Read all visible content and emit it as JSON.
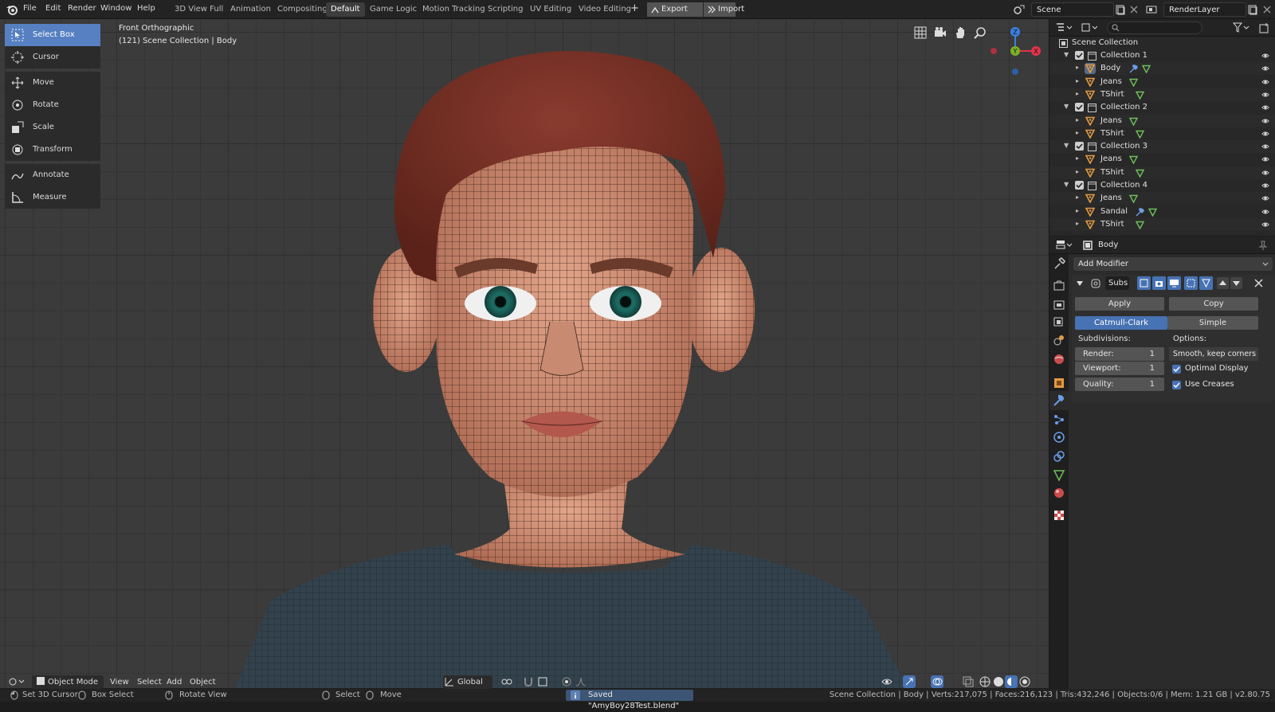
{
  "menus": [
    "File",
    "Edit",
    "Render",
    "Window",
    "Help"
  ],
  "workspaces": [
    "3D View Full",
    "Animation",
    "Compositing",
    "Default",
    "Game Logic",
    "Motion Tracking",
    "Scripting",
    "UV Editing",
    "Video Editing"
  ],
  "active_workspace": "Default",
  "topbar": {
    "export_label": "Export",
    "import_label": "Import",
    "scene": "Scene",
    "render_layer": "RenderLayer",
    "add_tab": "+"
  },
  "tools": [
    "Select Box",
    "Cursor",
    "Move",
    "Rotate",
    "Scale",
    "Transform",
    "Annotate",
    "Measure"
  ],
  "viewport": {
    "view_name": "Front Orthographic",
    "collection_info": "(121) Scene Collection | Body",
    "mode": "Object Mode",
    "menu_view": "View",
    "menu_select": "Select",
    "menu_add": "Add",
    "menu_object": "Object",
    "orientation": "Global",
    "gizmo_x": "X",
    "gizmo_y": "Y",
    "gizmo_z": "Z"
  },
  "outliner": {
    "root": "Scene Collection",
    "rows": [
      {
        "label": "Collection 1",
        "type": "collection"
      },
      {
        "label": "Body",
        "type": "object",
        "modifier": true,
        "selected": true
      },
      {
        "label": "Jeans",
        "type": "object"
      },
      {
        "label": "TShirt",
        "type": "object"
      },
      {
        "label": "Collection 2",
        "type": "collection"
      },
      {
        "label": "Jeans",
        "type": "object"
      },
      {
        "label": "TShirt",
        "type": "object"
      },
      {
        "label": "Collection 3",
        "type": "collection"
      },
      {
        "label": "Jeans",
        "type": "object"
      },
      {
        "label": "TShirt",
        "type": "object"
      },
      {
        "label": "Collection 4",
        "type": "collection"
      },
      {
        "label": "Jeans",
        "type": "object"
      },
      {
        "label": "Sandal",
        "type": "object",
        "modifier": true
      },
      {
        "label": "TShirt",
        "type": "object"
      }
    ]
  },
  "properties": {
    "object_name": "Body",
    "add_modifier": "Add Modifier",
    "modifier_name": "Subs",
    "apply": "Apply",
    "copy": "Copy",
    "catmull": "Catmull-Clark",
    "simple": "Simple",
    "subdivisions_label": "Subdivisions:",
    "options_label": "Options:",
    "render_label": "Render:",
    "render_value": "1",
    "viewport_label": "Viewport:",
    "viewport_value": "1",
    "quality_label": "Quality:",
    "quality_value": "1",
    "uv_smooth": "Smooth, keep corners",
    "optimal_display": "Optimal Display",
    "use_creases": "Use Creases"
  },
  "status": {
    "set_cursor": "Set 3D Cursor",
    "box_select": "Box Select",
    "rotate_view": "Rotate View",
    "select": "Select",
    "move": "Move",
    "saved": "Saved \"AmyBoy28Test.blend\"",
    "stats": "Scene Collection | Body | Verts:217,075 | Faces:216,123 | Tris:432,246 | Objects:0/6 | Mem: 1.21 GB | v2.80.75"
  },
  "colors": {
    "accent": "#5680c2",
    "object_icon": "#e39a42",
    "mesh_icon": "#6ec05a",
    "modifier_icon": "#6c9ee8",
    "gizmo_x": "#e2334a",
    "gizmo_y": "#7ab128",
    "gizmo_z": "#3b7fe0"
  }
}
